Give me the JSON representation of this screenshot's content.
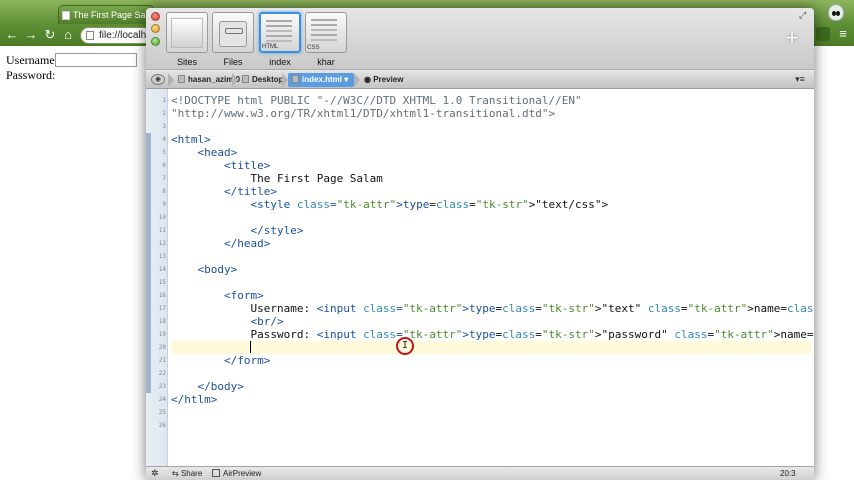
{
  "browser": {
    "tab_title": "The First Page Salam",
    "address": "file://localh",
    "back_glyph": "←",
    "forward_glyph": "→",
    "reload_glyph": "↻",
    "home_glyph": "⌂",
    "menu_glyph": "≡",
    "form": {
      "username_label": "Username:",
      "password_label": "Password:"
    }
  },
  "coda": {
    "tiles": [
      {
        "label": "Sites"
      },
      {
        "label": "Files"
      },
      {
        "label": "index",
        "thumb_text": "HTML",
        "selected": true
      },
      {
        "label": "khar",
        "thumb_text": "CSS"
      }
    ],
    "add_glyph": "+",
    "fullscreen_glyph": "⤢",
    "breadcrumb": {
      "eye_glyph": "◉",
      "items": [
        "hasan_azimi0",
        "Desktop",
        "index.html",
        "Preview"
      ]
    },
    "pathbar_right_glyph": "▾≡",
    "editor": {
      "line_numbers": [
        "1",
        "2",
        "3",
        "4",
        "5",
        "6",
        "7",
        "8",
        "9",
        "10",
        "11",
        "12",
        "13",
        "14",
        "15",
        "16",
        "17",
        "18",
        "19",
        "20",
        "21",
        "22",
        "23",
        "24",
        "25",
        "26"
      ],
      "lines": [
        "<!DOCTYPE html PUBLIC \"-//W3C//DTD XHTML 1.0 Transitional//EN\"",
        "\"http://www.w3.org/TR/xhtml1/DTD/xhtml1-transitional.dtd\">",
        "",
        "<html>",
        "    <head>",
        "        <title>",
        "            The First Page Salam",
        "        </title>",
        "            <style type=\"text/css\">",
        "",
        "            </style>",
        "        </head>",
        "",
        "    <body>",
        "",
        "        <form>",
        "            Username: <input type=\"text\" name=\"username\" />",
        "            <br/>",
        "            Password: <input type=\"password\" name=\"pass\" />",
        "            ",
        "        </form>",
        "",
        "    </body>",
        "</htlm>",
        "",
        ""
      ],
      "current_line": 20,
      "cursor_glyph": "I"
    },
    "status": {
      "gear_glyph": "✲",
      "share_label": "Share",
      "airpreview_label": "AirPreview",
      "cursor_position": "20:3"
    }
  }
}
